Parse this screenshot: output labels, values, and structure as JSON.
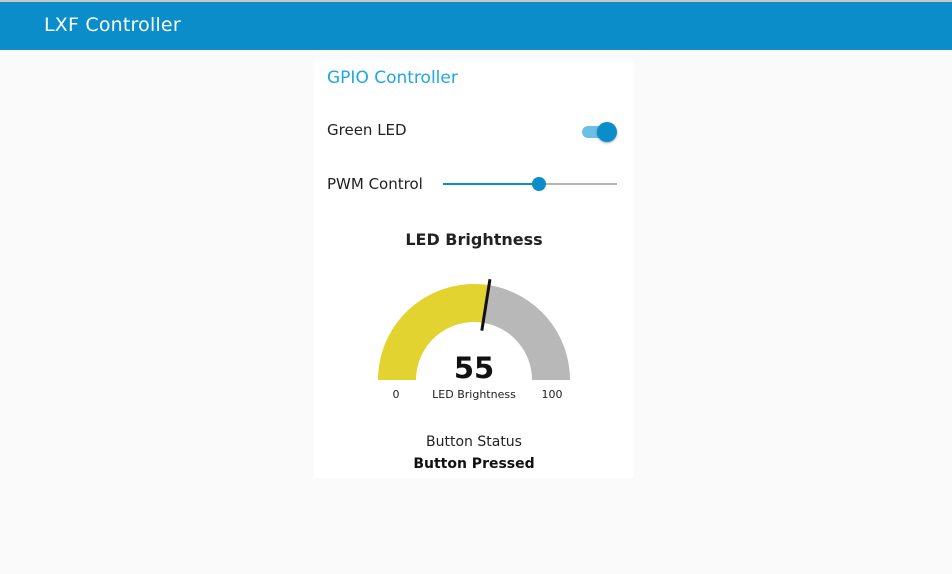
{
  "app": {
    "title": "LXF Controller",
    "accent": "#0b8dc9"
  },
  "card": {
    "title": "GPIO Controller",
    "title_color": "#1ea7e4"
  },
  "controls": {
    "led_label": "Green LED",
    "led_on": true,
    "pwm_label": "PWM Control",
    "pwm_value": 55,
    "pwm_min": 0,
    "pwm_max": 100
  },
  "gauge": {
    "title": "LED Brightness",
    "value": "55",
    "value_num": 55,
    "label": "LED Brightness",
    "min": "0",
    "max": "100",
    "fill_color": "#e2d330",
    "rest_color": "#b8b8b8"
  },
  "status": {
    "title": "Button Status",
    "value": "Button Pressed"
  }
}
